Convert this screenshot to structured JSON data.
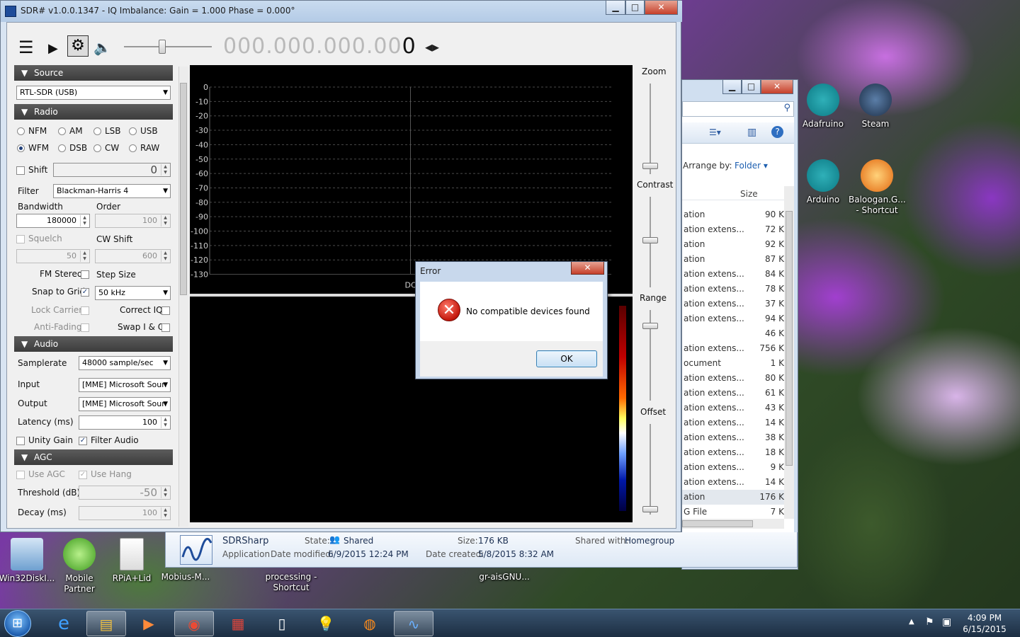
{
  "sdr": {
    "title": "SDR# v1.0.0.1347 - IQ Imbalance: Gain = 1.000 Phase = 0.000°",
    "freq_main": "000.000.000.00",
    "freq_last": "0",
    "source": {
      "header": "Source",
      "device": "RTL-SDR (USB)"
    },
    "radio": {
      "header": "Radio",
      "modes": [
        "NFM",
        "AM",
        "LSB",
        "USB",
        "WFM",
        "DSB",
        "CW",
        "RAW"
      ],
      "selected_mode": "WFM",
      "shift_label": "Shift",
      "shift_value": "0",
      "filter_label": "Filter",
      "filter_value": "Blackman-Harris 4",
      "bandwidth_label": "Bandwidth",
      "bandwidth_value": "180000",
      "order_label": "Order",
      "order_value": "100",
      "squelch_label": "Squelch",
      "squelch_value": "50",
      "cwshift_label": "CW Shift",
      "cwshift_value": "600",
      "fmstereo_label": "FM Stereo",
      "stepsize_label": "Step Size",
      "snap_label": "Snap to Grid",
      "step_value": "50 kHz",
      "lockcarrier_label": "Lock Carrier",
      "correctiq_label": "Correct IQ",
      "antifading_label": "Anti-Fading",
      "swapiq_label": "Swap I & Q"
    },
    "audio": {
      "header": "Audio",
      "samplerate_label": "Samplerate",
      "samplerate_value": "48000 sample/sec",
      "input_label": "Input",
      "input_value": "[MME] Microsoft Soun",
      "output_label": "Output",
      "output_value": "[MME] Microsoft Soun",
      "latency_label": "Latency (ms)",
      "latency_value": "100",
      "unity_label": "Unity Gain",
      "filter_audio_label": "Filter Audio"
    },
    "agc": {
      "header": "AGC",
      "useagc_label": "Use AGC",
      "usehang_label": "Use Hang",
      "threshold_label": "Threshold (dB)",
      "threshold_value": "-50",
      "decay_label": "Decay (ms)",
      "decay_value": "100"
    },
    "spectrum": {
      "y_ticks": [
        "0",
        "-10",
        "-20",
        "-30",
        "-40",
        "-50",
        "-60",
        "-70",
        "-80",
        "-90",
        "-100",
        "-110",
        "-120",
        "-130"
      ],
      "center_label": "DC"
    },
    "sliders": {
      "zoom": "Zoom",
      "contrast": "Contrast",
      "range": "Range",
      "offset": "Offset"
    }
  },
  "error_dialog": {
    "title": "Error",
    "message": "No compatible devices found",
    "ok": "OK"
  },
  "explorer": {
    "arrange_label": "Arrange by:",
    "arrange_value": "Folder",
    "size_header": "Size",
    "rows": [
      {
        "name": "ation",
        "size": "90 K"
      },
      {
        "name": "ation extens...",
        "size": "72 K"
      },
      {
        "name": "ation",
        "size": "92 K"
      },
      {
        "name": "ation",
        "size": "87 K"
      },
      {
        "name": "ation extens...",
        "size": "84 K"
      },
      {
        "name": "ation extens...",
        "size": "78 K"
      },
      {
        "name": "ation extens...",
        "size": "37 K"
      },
      {
        "name": "ation extens...",
        "size": "94 K"
      },
      {
        "name": "",
        "size": "46 K"
      },
      {
        "name": "ation extens...",
        "size": "756 K"
      },
      {
        "name": "ocument",
        "size": "1 K"
      },
      {
        "name": "ation extens...",
        "size": "80 K"
      },
      {
        "name": "ation extens...",
        "size": "61 K"
      },
      {
        "name": "ation extens...",
        "size": "43 K"
      },
      {
        "name": "ation extens...",
        "size": "14 K"
      },
      {
        "name": "ation extens...",
        "size": "38 K"
      },
      {
        "name": "ation extens...",
        "size": "18 K"
      },
      {
        "name": "ation extens...",
        "size": "9 K"
      },
      {
        "name": "ation extens...",
        "size": "14 K"
      },
      {
        "name": "ation",
        "size": "176 K"
      },
      {
        "name": "G File",
        "size": "7 K"
      }
    ]
  },
  "details": {
    "name": "SDRSharp",
    "type": "Application",
    "state_label": "State:",
    "state_value": "Shared",
    "size_label": "Size:",
    "size_value": "176 KB",
    "shared_label": "Shared with:",
    "shared_value": "Homegroup",
    "modified_label": "Date modified:",
    "modified_value": "6/9/2015 12:24 PM",
    "created_label": "Date created:",
    "created_value": "5/8/2015 8:32 AM"
  },
  "desktop": {
    "right_icons": [
      "Adafruino",
      "Steam",
      "Arduino",
      "Baloogan.G... - Shortcut"
    ],
    "bottom_icons": [
      "Win32DiskI...",
      "Mobile Partner",
      "RPiA+Lid",
      "Mobius-M...",
      "processing - Shortcut",
      "gr-aisGNU..."
    ]
  },
  "taskbar": {
    "time": "4:09 PM",
    "date": "6/15/2015"
  },
  "colors": {
    "accent": "#1f3f7a",
    "section_header": "#4a4a4a",
    "error_red": "#c4180c"
  }
}
